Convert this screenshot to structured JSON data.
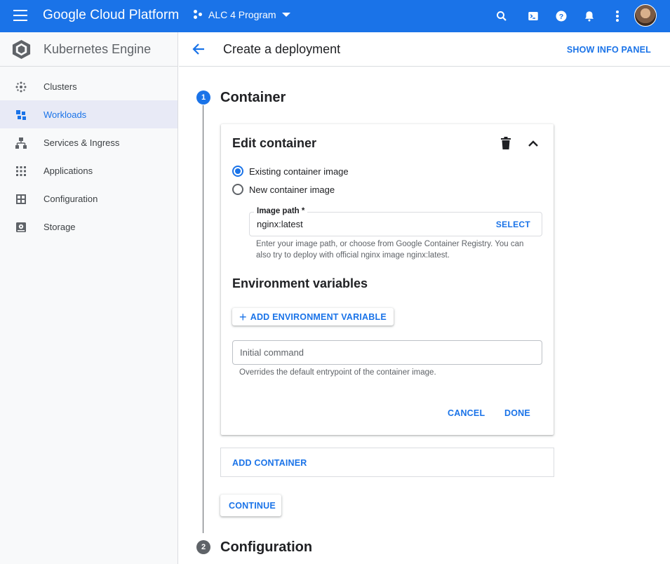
{
  "appbar": {
    "brand": "Google Cloud Platform",
    "project": "ALC 4 Program",
    "icons": [
      "menu-icon",
      "search-icon",
      "cloud-shell-icon",
      "help-icon",
      "notifications-icon",
      "more-vert-icon",
      "avatar"
    ]
  },
  "sidebar": {
    "title": "Kubernetes Engine",
    "items": [
      {
        "label": "Clusters",
        "icon": "clusters-icon",
        "active": false
      },
      {
        "label": "Workloads",
        "icon": "workloads-icon",
        "active": true
      },
      {
        "label": "Services & Ingress",
        "icon": "services-icon",
        "active": false
      },
      {
        "label": "Applications",
        "icon": "applications-icon",
        "active": false
      },
      {
        "label": "Configuration",
        "icon": "configuration-icon",
        "active": false
      },
      {
        "label": "Storage",
        "icon": "storage-icon",
        "active": false
      }
    ]
  },
  "header": {
    "title": "Create a deployment",
    "info_panel": "SHOW INFO PANEL"
  },
  "steps": [
    {
      "number": "1",
      "title": "Container"
    },
    {
      "number": "2",
      "title": "Configuration"
    }
  ],
  "container_card": {
    "title": "Edit container",
    "radio_existing": "Existing container image",
    "radio_new": "New container image",
    "selected": "existing",
    "image_path_label": "Image path *",
    "image_path_value": "nginx:latest",
    "select_label": "SELECT",
    "image_helper": "Enter your image path, or choose from Google Container Registry. You can also try to deploy with official nginx image nginx:latest.",
    "env_title": "Environment variables",
    "add_env": "ADD ENVIRONMENT VARIABLE",
    "initial_command_placeholder": "Initial command",
    "command_helper": "Overrides the default entrypoint of the container image.",
    "cancel": "CANCEL",
    "done": "DONE"
  },
  "add_container": "ADD CONTAINER",
  "continue": "CONTINUE",
  "colors": {
    "primary": "#1a73e8",
    "sidebar_bg": "#f8f9fa",
    "active_bg": "#e8eaf6"
  }
}
